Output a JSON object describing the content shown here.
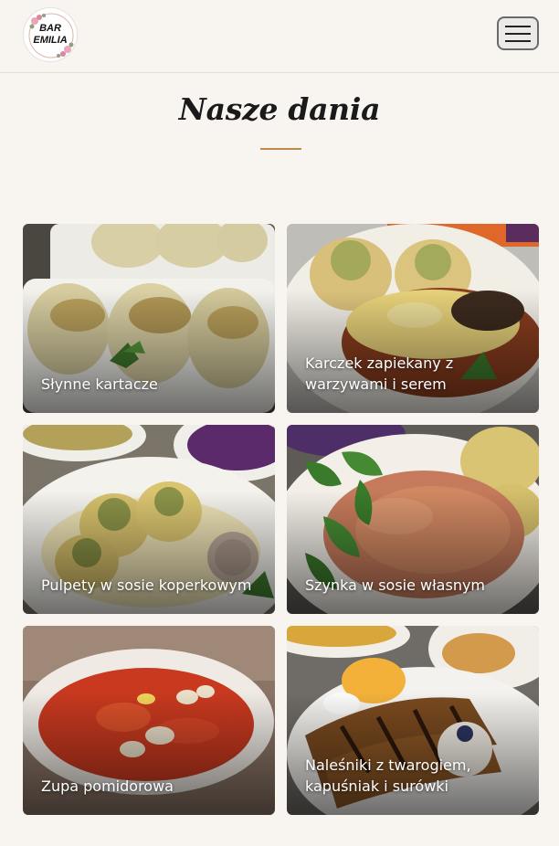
{
  "header": {
    "logo": {
      "line1": "BAR",
      "line2": "EMILIA"
    },
    "menu_icon": "hamburger-menu-icon"
  },
  "main": {
    "title": "Nasze dania",
    "accent_color": "#c08a4a",
    "dishes": [
      {
        "label": "Słynne kartacze"
      },
      {
        "label": "Karczek zapiekany z warzywami i serem"
      },
      {
        "label": "Pulpety w sosie koperkowym"
      },
      {
        "label": "Szynka w sosie własnym"
      },
      {
        "label": "Zupa pomidorowa"
      },
      {
        "label": "Naleśniki z twarogiem, kapuśniak i surówki"
      }
    ]
  }
}
